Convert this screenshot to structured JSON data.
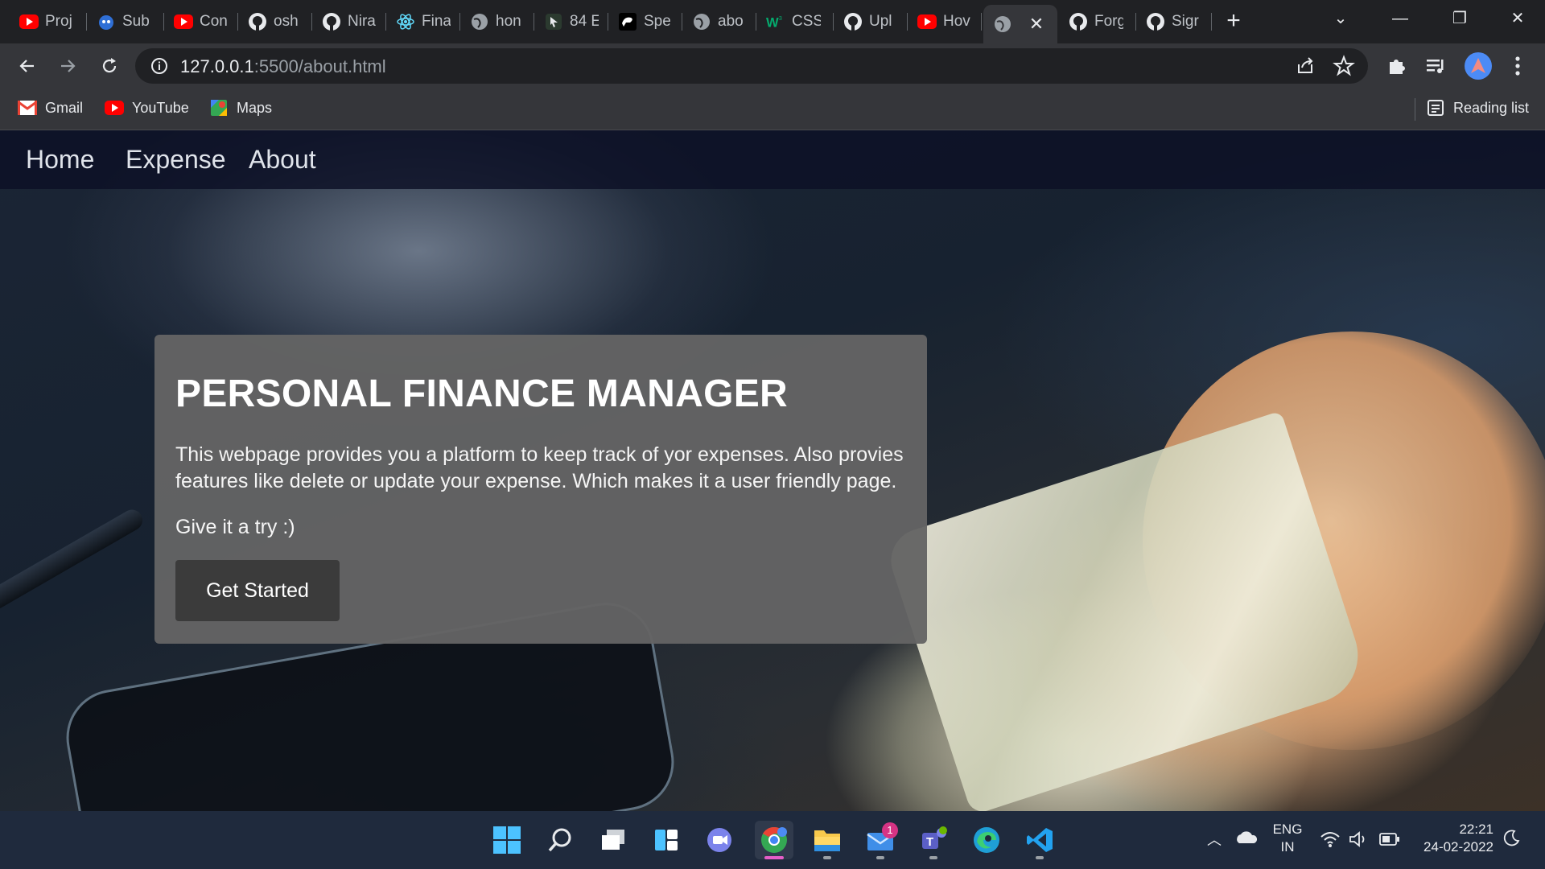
{
  "browser": {
    "tabs": [
      {
        "label": "Proj",
        "icon": "youtube-icon"
      },
      {
        "label": "Sub",
        "icon": "bot-icon"
      },
      {
        "label": "Con",
        "icon": "youtube-icon"
      },
      {
        "label": "osh",
        "icon": "github-icon"
      },
      {
        "label": "Nira",
        "icon": "github-icon"
      },
      {
        "label": "Fina",
        "icon": "react-icon"
      },
      {
        "label": "hon",
        "icon": "globe-icon"
      },
      {
        "label": "84 E",
        "icon": "cursor-icon"
      },
      {
        "label": "Spe",
        "icon": "speech-icon"
      },
      {
        "label": "abo",
        "icon": "globe-icon"
      },
      {
        "label": "CSS",
        "icon": "w3-icon"
      },
      {
        "label": "Upl",
        "icon": "github-icon"
      },
      {
        "label": "Hov",
        "icon": "youtube-icon"
      },
      {
        "label": "",
        "icon": "globe-icon",
        "active": true
      },
      {
        "label": "Forg",
        "icon": "github-icon"
      },
      {
        "label": "Sigr",
        "icon": "github-icon"
      }
    ],
    "url_host": "127.0.0.1",
    "url_rest": ":5500/about.html",
    "bookmarks": [
      {
        "label": "Gmail",
        "icon": "gmail-icon"
      },
      {
        "label": "YouTube",
        "icon": "youtube-icon"
      },
      {
        "label": "Maps",
        "icon": "maps-icon"
      }
    ],
    "reading_list": "Reading list"
  },
  "page": {
    "nav": [
      "Home",
      "Expense",
      "About"
    ],
    "title": "PERSONAL FINANCE MANAGER",
    "description": "This webpage provides you a platform to keep track of yor expenses. Also provies features like delete or update your expense. Which makes it a user friendly page.",
    "try_text": "Give it a try :)",
    "cta": "Get Started"
  },
  "taskbar": {
    "lang_line1": "ENG",
    "lang_line2": "IN",
    "time": "22:21",
    "date": "24-02-2022",
    "mail_badge": "1"
  },
  "colors": {
    "youtube": "#ff0000",
    "tab_bg": "#202124",
    "toolbar_bg": "#35363a",
    "card_bg": "#646464",
    "button_bg": "#3b3b3b"
  }
}
